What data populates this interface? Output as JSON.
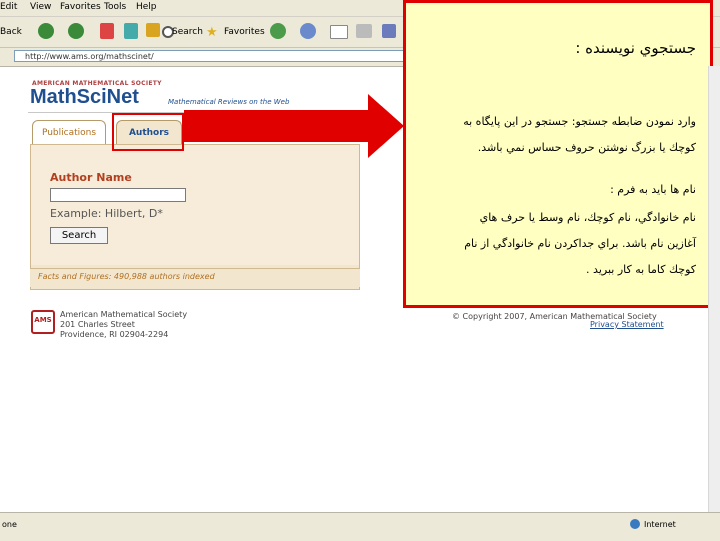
{
  "menu": {
    "items": [
      "Edit",
      "View",
      "Favorites",
      "Tools",
      "Help"
    ]
  },
  "toolbar": {
    "back": "Back",
    "search": "Search",
    "favorites": "Favorites"
  },
  "address": {
    "url": "http://www.ams.org/mathscinet/"
  },
  "logo": {
    "org": "AMERICAN MATHEMATICAL SOCIETY",
    "name": "MathSciNet",
    "tagline": "Mathematical Reviews on the Web"
  },
  "tabs": {
    "publications": "Publications",
    "authors": "Authors"
  },
  "form": {
    "heading": "Author Name",
    "example": "Example: Hilbert, D*",
    "search_button": "Search"
  },
  "facts": "Facts and Figures: 490,988 authors indexed",
  "footer": {
    "ams_badge": "AMS",
    "society": "American Mathematical Society",
    "street": "201 Charles Street",
    "city": "Providence, RI 02904-2294",
    "copyright": "© Copyright 2007, American Mathematical Society",
    "privacy": "Privacy Statement"
  },
  "annotation": {
    "title": "جستجوي نويسنده :",
    "line1": "وارد نمودن ضابطه جستجو: جستجو در اين پايگاه به",
    "line2": "كوچك يا بزرگ نوشتن حروف حساس نمي باشد.",
    "line3": "نام ها بايد به فرم :",
    "line4": "نام خانوادگي، نام كوچك، نام وسط يا حرف هاي",
    "line5": "آغازين نام باشد. براي جداكردن نام خانوادگي از نام",
    "line6": "كوچك كاما به كار ببريد ."
  },
  "status": {
    "left": "one",
    "zone": "Internet"
  },
  "colors": {
    "highlight_red": "#e00000",
    "note_bg": "#ffffc2",
    "brand_blue": "#1f4f8f",
    "panel": "#f3e6cf"
  }
}
